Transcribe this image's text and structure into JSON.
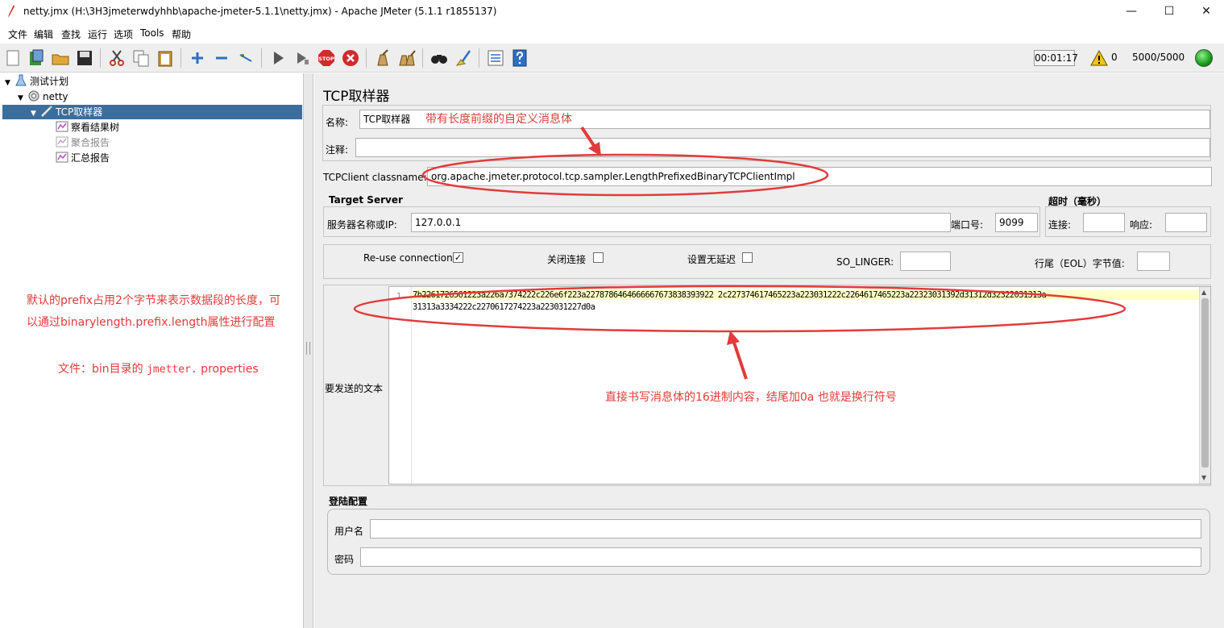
{
  "window": {
    "title": "netty.jmx (H:\\3H3jmeterwdyhhb\\apache-jmeter-5.1.1\\netty.jmx) - Apache JMeter (5.1.1 r1855137)",
    "minimize": "—",
    "maximize": "☐",
    "close": "✕"
  },
  "menu": {
    "items": [
      "文件",
      "编辑",
      "查找",
      "运行",
      "选项",
      "Tools",
      "帮助"
    ]
  },
  "toolbar": {
    "icons": [
      "new-icon",
      "templates-icon",
      "open-icon",
      "save-icon",
      "cut-icon",
      "copy-icon",
      "paste-icon",
      "expand-icon",
      "collapse-icon",
      "toggle-icon",
      "start-icon",
      "start-no-pause-icon",
      "stop-icon",
      "shutdown-icon",
      "clear-icon",
      "clear-all-icon",
      "search-icon",
      "reset-search-icon",
      "function-helper-icon",
      "help-icon"
    ],
    "stop_label": "STOP",
    "timer": "00:01:17",
    "warning_count": "0",
    "thread_count": "5000/5000"
  },
  "tree": {
    "items": [
      {
        "label": "测试计划",
        "icon": "test-plan-icon"
      },
      {
        "label": "netty",
        "icon": "thread-group-icon"
      },
      {
        "label": "TCP取样器",
        "icon": "sampler-icon"
      },
      {
        "label": "察看结果树",
        "icon": "listener-icon"
      },
      {
        "label": "聚合报告",
        "icon": "listener-icon"
      },
      {
        "label": "汇总报告",
        "icon": "listener-icon"
      }
    ]
  },
  "sampler": {
    "title": "TCP取样器",
    "name_label": "名称:",
    "name_value": "TCP取样器",
    "comment_label": "注释:",
    "comment_value": "",
    "classname_label": "TCPClient classname:",
    "classname_value": "org.apache.jmeter.protocol.tcp.sampler.LengthPrefixedBinaryTCPClientImpl",
    "target_server_title": "Target Server",
    "server_label": "服务器名称或IP:",
    "server_value": "127.0.0.1",
    "port_label": "端口号:",
    "port_value": "9099",
    "timeout_title": "超时（毫秒）",
    "connect_label": "连接:",
    "connect_value": "",
    "response_label": "响应:",
    "response_value": "",
    "reuse_label": "Re-use connection",
    "reuse_checked": "✓",
    "close_conn_label": "关闭连接",
    "nodelay_label": "设置无延迟",
    "so_linger_label": "SO_LINGER:",
    "so_linger_value": "",
    "eol_label": "行尾（EOL）字节值:",
    "eol_value": "",
    "text_to_send_label": "要发送的文本",
    "line_number": "1",
    "code_line_1": "7b2261726561223a226a7374222c226e6f223a2278786464666667673838393922 2c227374617465223a223031222c2264617465223a22323031392d31312d32322031313a",
    "code_line_2": "31313a3334222c2270617274223a223031227d0a",
    "login_title": "登陆配置",
    "username_label": "用户名",
    "username_value": "",
    "password_label": "密码",
    "password_value": ""
  },
  "annotations": {
    "name_note": "带有长度前缀的自定义消息体",
    "prefix_note_line1": "默认的prefix占用2个字节来表示数据段的长度，可",
    "prefix_note_line2": "以通过binarylength.prefix.length属性进行配置",
    "file_note_prefix": "文件：bin目录的 ",
    "file_note_mono": "jmetter.",
    "file_note_suffix": " properties",
    "hex_note": "直接书写消息体的16进制内容，结尾加0a 也就是换行符号"
  },
  "colors": {
    "annotation_red": "#e23b3b",
    "selection_blue": "#3b6e9c",
    "code_highlight": "#ffffc8"
  }
}
